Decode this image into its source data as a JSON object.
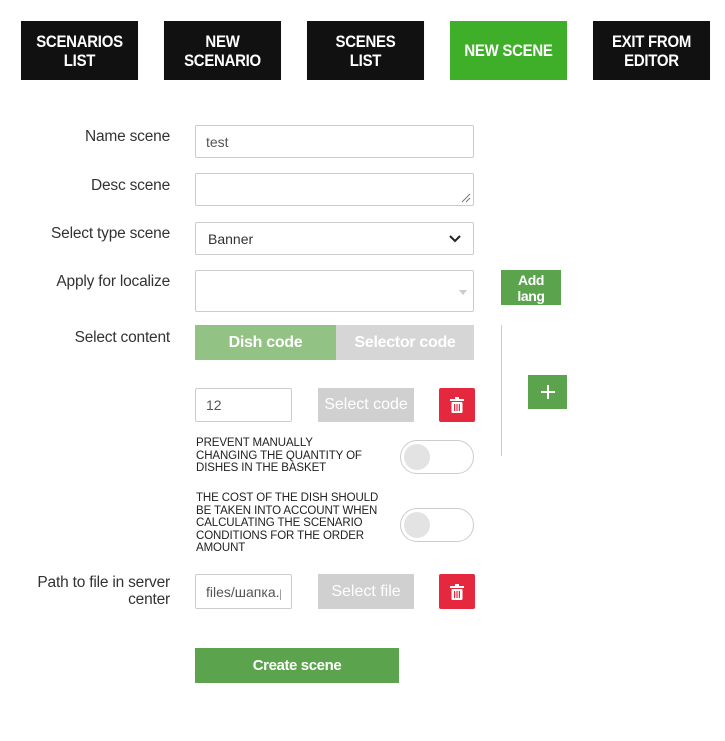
{
  "nav": {
    "scenarios_list": [
      "SCENARIOS",
      "LIST"
    ],
    "new_scenario": [
      "NEW",
      "SCENARIO"
    ],
    "scenes_list": [
      "SCENES",
      "LIST"
    ],
    "new_scene": "NEW SCENE",
    "exit_editor": [
      "EXIT FROM",
      "EDITOR"
    ]
  },
  "form": {
    "name_label": "Name scene",
    "name_value": "test",
    "desc_label": "Desc scene",
    "desc_value": "",
    "type_label": "Select type scene",
    "type_value": "Banner",
    "localize_label": "Apply for localize",
    "localize_value": "",
    "add_lang_label": "Add lang",
    "content_label": "Select content",
    "tab_dish_code": "Dish code",
    "tab_selector_code": "Selector code",
    "code_value": "12",
    "select_code_label": "Select code",
    "plus_label": "+",
    "prevent_text": "PREVENT MANUALLY CHANGING THE QUANTITY OF DISHES IN THE BASKET",
    "cost_text": "THE COST OF THE DISH SHOULD BE TAKEN INTO ACCOUNT WHEN CALCULATING THE SCENARIO CONDITIONS FOR THE ORDER AMOUNT",
    "path_label": "Path to file in server center",
    "path_value": "files/шапка.p",
    "select_file_label": "Select file",
    "create_label": "Create scene"
  },
  "colors": {
    "active_tab": "#3fae29",
    "nav_bg": "#111111",
    "primary_green": "#5ba34d",
    "disabled_grey": "#d0d0d0",
    "danger_red": "#e5283e"
  },
  "icons": {
    "delete": "trash-icon",
    "dropdown": "chevron-down-icon",
    "add": "plus-icon"
  }
}
